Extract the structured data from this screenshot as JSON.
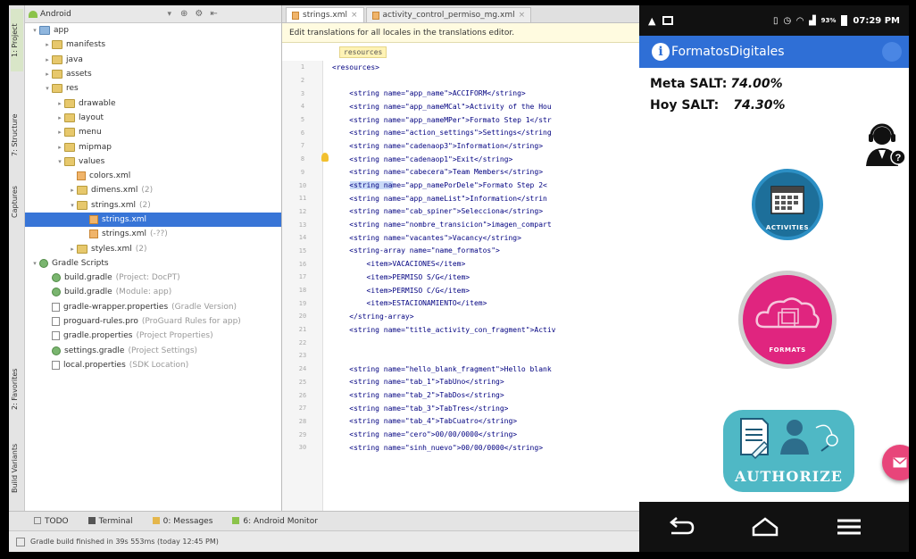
{
  "studio": {
    "side_tabs": [
      "1: Project",
      "7: Structure",
      "Captures",
      "2: Favorites",
      "Build Variants"
    ],
    "project_view": "Android",
    "tree": [
      {
        "label": "app",
        "sub": "",
        "indent": 0,
        "icon": "folder-blue",
        "arrow": "▾"
      },
      {
        "label": "manifests",
        "sub": "",
        "indent": 1,
        "icon": "folder",
        "arrow": "▸"
      },
      {
        "label": "java",
        "sub": "",
        "indent": 1,
        "icon": "folder",
        "arrow": "▸"
      },
      {
        "label": "assets",
        "sub": "",
        "indent": 1,
        "icon": "folder",
        "arrow": "▸"
      },
      {
        "label": "res",
        "sub": "",
        "indent": 1,
        "icon": "folder",
        "arrow": "▾"
      },
      {
        "label": "drawable",
        "sub": "",
        "indent": 2,
        "icon": "folder",
        "arrow": "▸"
      },
      {
        "label": "layout",
        "sub": "",
        "indent": 2,
        "icon": "folder",
        "arrow": "▸"
      },
      {
        "label": "menu",
        "sub": "",
        "indent": 2,
        "icon": "folder",
        "arrow": "▸"
      },
      {
        "label": "mipmap",
        "sub": "",
        "indent": 2,
        "icon": "folder",
        "arrow": "▸"
      },
      {
        "label": "values",
        "sub": "",
        "indent": 2,
        "icon": "folder",
        "arrow": "▾"
      },
      {
        "label": "colors.xml",
        "sub": "",
        "indent": 3,
        "icon": "xml",
        "arrow": ""
      },
      {
        "label": "dimens.xml",
        "sub": "(2)",
        "indent": 3,
        "icon": "folder",
        "arrow": "▸"
      },
      {
        "label": "strings.xml",
        "sub": "(2)",
        "indent": 3,
        "icon": "folder",
        "arrow": "▾"
      },
      {
        "label": "strings.xml",
        "sub": "",
        "indent": 4,
        "icon": "xml",
        "arrow": "",
        "selected": true
      },
      {
        "label": "strings.xml",
        "sub": "(-??)",
        "indent": 4,
        "icon": "xml",
        "arrow": ""
      },
      {
        "label": "styles.xml",
        "sub": "(2)",
        "indent": 3,
        "icon": "folder",
        "arrow": "▸"
      },
      {
        "label": "Gradle Scripts",
        "sub": "",
        "indent": 0,
        "icon": "gradle",
        "arrow": "▾"
      },
      {
        "label": "build.gradle",
        "sub": "(Project: DocPT)",
        "indent": 1,
        "icon": "gradle",
        "arrow": ""
      },
      {
        "label": "build.gradle",
        "sub": "(Module: app)",
        "indent": 1,
        "icon": "gradle",
        "arrow": ""
      },
      {
        "label": "gradle-wrapper.properties",
        "sub": "(Gradle Version)",
        "indent": 1,
        "icon": "file",
        "arrow": ""
      },
      {
        "label": "proguard-rules.pro",
        "sub": "(ProGuard Rules for app)",
        "indent": 1,
        "icon": "file",
        "arrow": ""
      },
      {
        "label": "gradle.properties",
        "sub": "(Project Properties)",
        "indent": 1,
        "icon": "file",
        "arrow": ""
      },
      {
        "label": "settings.gradle",
        "sub": "(Project Settings)",
        "indent": 1,
        "icon": "gradle",
        "arrow": ""
      },
      {
        "label": "local.properties",
        "sub": "(SDK Location)",
        "indent": 1,
        "icon": "file",
        "arrow": ""
      }
    ],
    "editor_tabs": [
      {
        "label": "strings.xml",
        "active": true
      },
      {
        "label": "activity_control_permiso_mg.xml",
        "active": false
      }
    ],
    "notice": "Edit translations for all locales in the translations editor.",
    "crumb": "resources",
    "code_lines": [
      {
        "n": "1",
        "t": "<resources>"
      },
      {
        "n": "2",
        "t": ""
      },
      {
        "n": "3",
        "t": "    <string name=\"app_name\">ACCIFORM</string>"
      },
      {
        "n": "4",
        "t": "    <string name=\"app_nameMCal\">Activity of the Hou"
      },
      {
        "n": "5",
        "t": "    <string name=\"app_nameMPer\">Formato Step 1</str"
      },
      {
        "n": "6",
        "t": "    <string name=\"action_settings\">Settings</string"
      },
      {
        "n": "7",
        "t": "    <string name=\"cadenaop3\">Information</string>"
      },
      {
        "n": "8",
        "t": "    <string name=\"cadenaop1\">Exit</string>"
      },
      {
        "n": "9",
        "t": "    <string name=\"cabecera\">Team Members</string>"
      },
      {
        "n": "10",
        "t": "    <string name=\"app_namePorDele\">Formato Step 2<",
        "hl": true
      },
      {
        "n": "11",
        "t": "    <string name=\"app_nameList\">Information</strin"
      },
      {
        "n": "12",
        "t": "    <string name=\"cab_spiner\">Selecciona</string>"
      },
      {
        "n": "13",
        "t": "    <string name=\"nombre_transicion\">imagen_compart"
      },
      {
        "n": "14",
        "t": "    <string name=\"vacantes\">Vacancy</string>"
      },
      {
        "n": "15",
        "t": "    <string-array name=\"name_formatos\">"
      },
      {
        "n": "16",
        "t": "        <item>VACACIONES</item>"
      },
      {
        "n": "17",
        "t": "        <item>PERMISO S/G</item>"
      },
      {
        "n": "18",
        "t": "        <item>PERMISO C/G</item>"
      },
      {
        "n": "19",
        "t": "        <item>ESTACIONAMIENTO</item>"
      },
      {
        "n": "20",
        "t": "    </string-array>"
      },
      {
        "n": "21",
        "t": "    <string name=\"title_activity_con_fragment\">Activ"
      },
      {
        "n": "22",
        "t": ""
      },
      {
        "n": "23",
        "t": ""
      },
      {
        "n": "24",
        "t": "    <string name=\"hello_blank_fragment\">Hello blank"
      },
      {
        "n": "25",
        "t": "    <string name=\"tab_1\">TabUno</string>"
      },
      {
        "n": "26",
        "t": "    <string name=\"tab_2\">TabDos</string>"
      },
      {
        "n": "27",
        "t": "    <string name=\"tab_3\">TabTres</string>"
      },
      {
        "n": "28",
        "t": "    <string name=\"tab_4\">TabCuatro</string>"
      },
      {
        "n": "29",
        "t": "    <string name=\"cero\">00/00/0000</string>"
      },
      {
        "n": "30",
        "t": "    <string name=\"sinh_nuevo\">00/00/0000</string>"
      }
    ],
    "bottom_tabs": [
      "TODO",
      "Terminal",
      "0: Messages",
      "6: Android Monitor"
    ],
    "status": "Gradle build finished in 39s 553ms (today 12:45 PM)"
  },
  "phone": {
    "time": "07:29 PM",
    "battery": "93%",
    "app_title": "FormatosDigitales",
    "meta_label": "Meta SALT:",
    "meta_value": "74.00%",
    "hoy_label": "Hoy SALT:",
    "hoy_value": "74.30%",
    "btn_activities": "ACTIVITIES",
    "btn_formats": "FORMATS",
    "btn_authorize": "AUTHORIZE",
    "colors": {
      "appbar": "#2f6fd6",
      "formats": "#e0257f",
      "authorize": "#4fb8c5",
      "fab": "#e8457a"
    }
  }
}
